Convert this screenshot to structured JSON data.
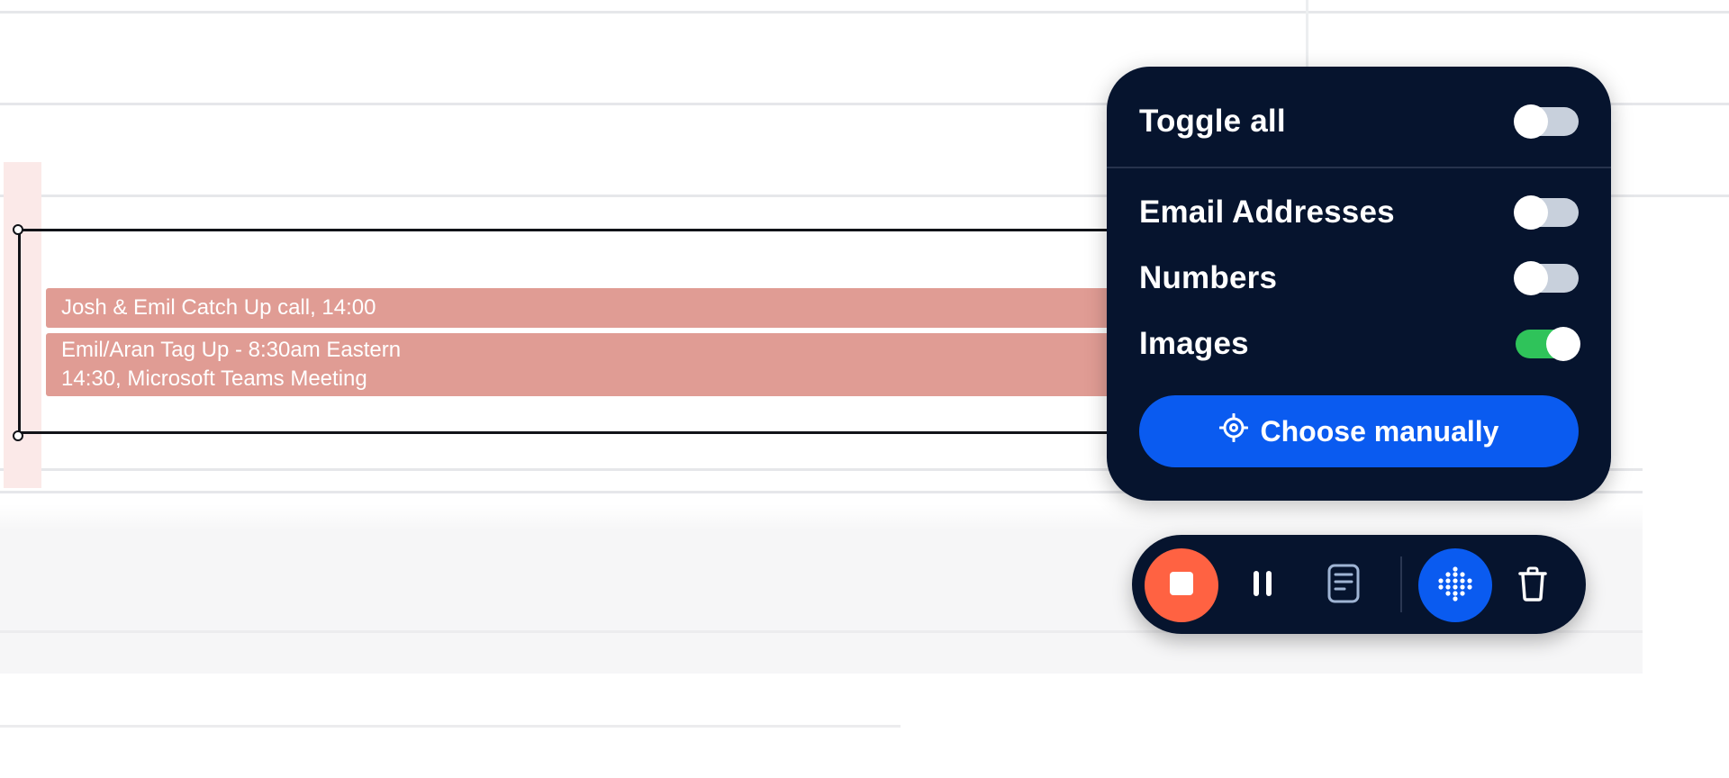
{
  "popup": {
    "toggle_all_label": "Toggle all",
    "toggle_all_on": false,
    "options": [
      {
        "label": "Email Addresses",
        "on": false
      },
      {
        "label": "Numbers",
        "on": false
      },
      {
        "label": "Images",
        "on": true
      }
    ],
    "choose_button_label": "Choose manually",
    "choose_icon": "target-icon"
  },
  "calendar": {
    "events": [
      {
        "title": "Josh & Emil Catch Up call, 14:00",
        "detail": ""
      },
      {
        "title": "Emil/Aran Tag Up - 8:30am Eastern",
        "detail": "14:30, Microsoft Teams Meeting"
      }
    ],
    "event_color": "#e09c94"
  },
  "toolbar": {
    "buttons": [
      "stop-icon",
      "pause-icon",
      "notes-icon",
      "keypad-icon",
      "trash-icon"
    ],
    "stop_color": "#ff6242",
    "keypad_color": "#0a5bf0"
  },
  "colors": {
    "popup_bg": "#06142e",
    "accent_blue": "#0a5bf0",
    "toggle_on": "#2fc35a",
    "toggle_off": "#c8d0dc"
  }
}
